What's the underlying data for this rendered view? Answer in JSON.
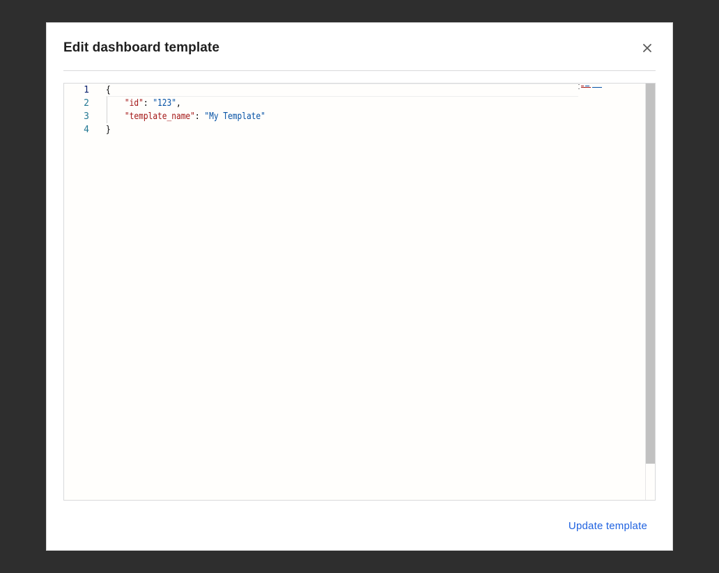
{
  "modal": {
    "title": "Edit dashboard template",
    "close_icon": "close-icon",
    "submit_label": "Update template"
  },
  "editor": {
    "language": "json",
    "active_line": 1,
    "line_numbers": [
      "1",
      "2",
      "3",
      "4"
    ],
    "lines": [
      {
        "indent": "",
        "parts": [
          {
            "t": "{",
            "c": "punct"
          }
        ]
      },
      {
        "indent": "    ",
        "parts": [
          {
            "t": "\"id\"",
            "c": "key"
          },
          {
            "t": ": ",
            "c": "punct"
          },
          {
            "t": "\"123\"",
            "c": "str"
          },
          {
            "t": ",",
            "c": "punct"
          }
        ]
      },
      {
        "indent": "    ",
        "parts": [
          {
            "t": "\"template_name\"",
            "c": "key"
          },
          {
            "t": ": ",
            "c": "punct"
          },
          {
            "t": "\"My Template\"",
            "c": "str"
          }
        ]
      },
      {
        "indent": "",
        "parts": [
          {
            "t": "}",
            "c": "punct"
          }
        ]
      }
    ]
  },
  "colors": {
    "overlay": "#2e2e2e",
    "accent": "#1f62e0",
    "line_number": "#237893",
    "json_key": "#a31515",
    "json_string": "#0451a5"
  }
}
